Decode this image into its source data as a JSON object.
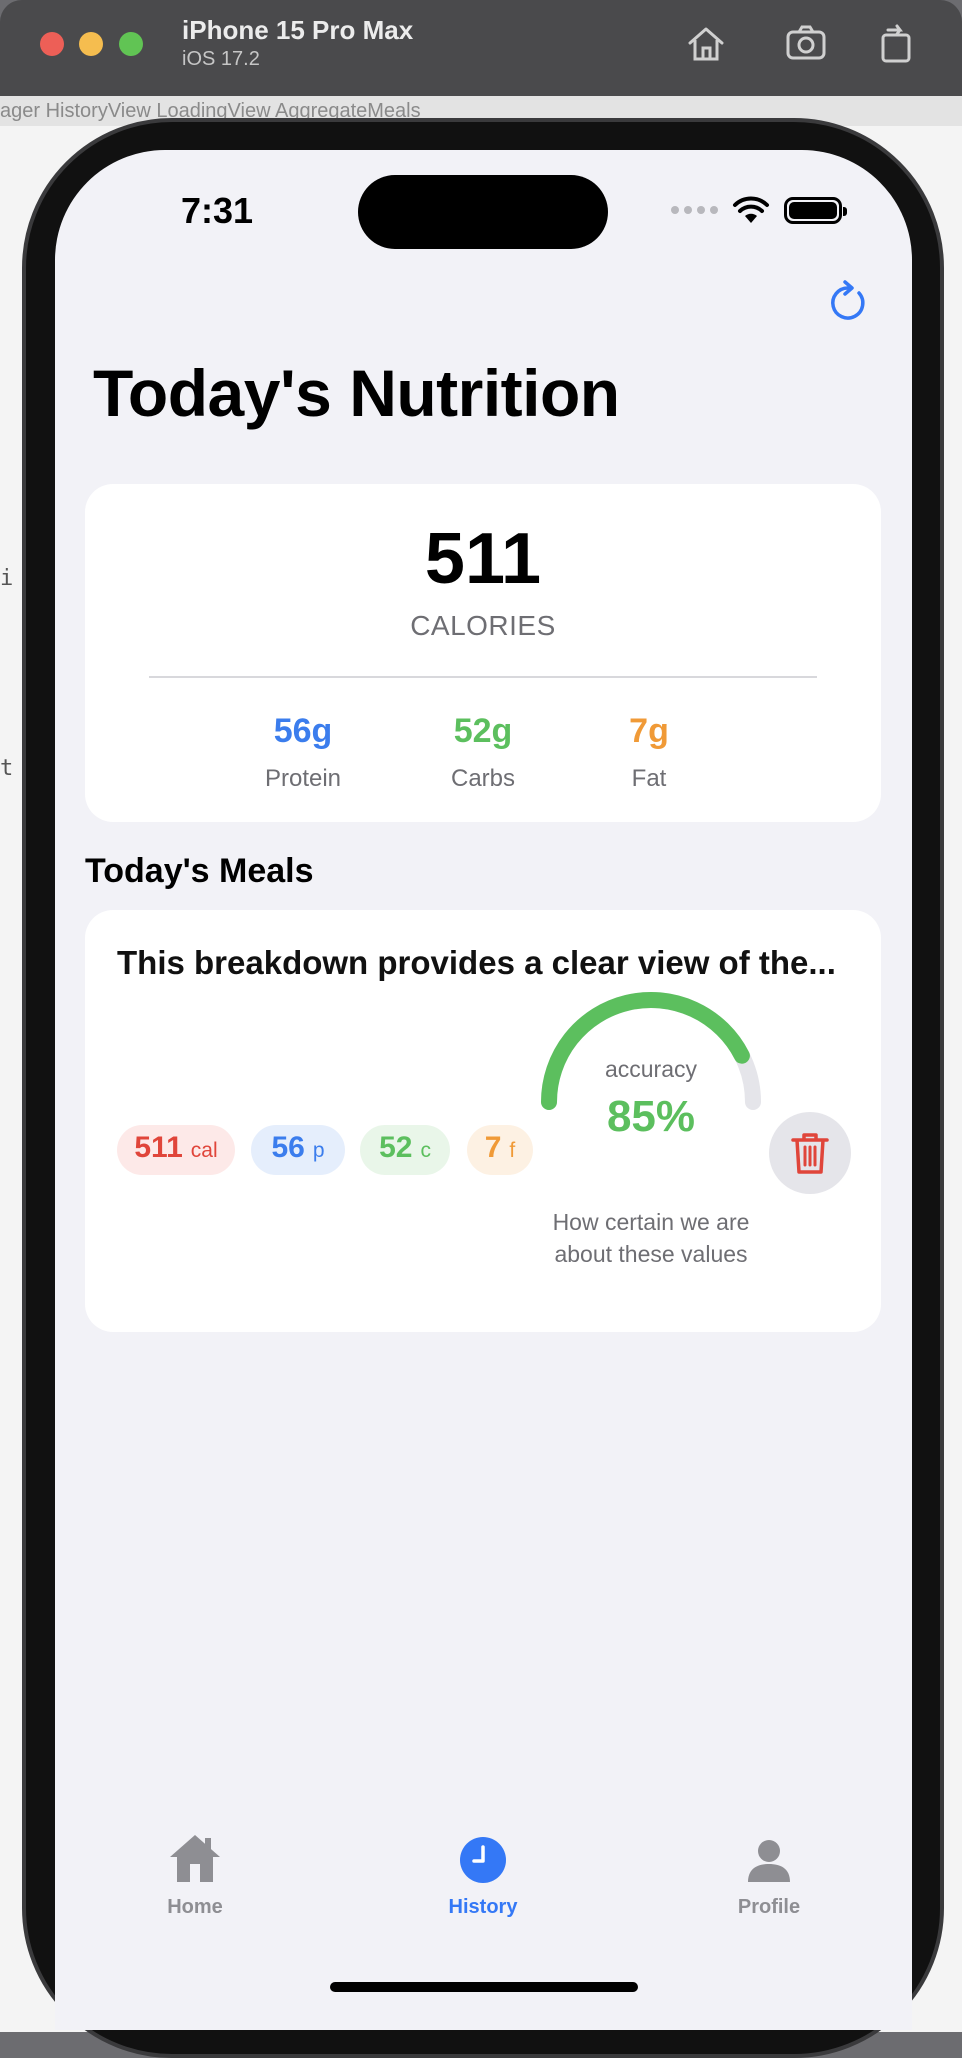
{
  "simulator": {
    "device_name": "iPhone 15 Pro Max",
    "os_version": "iOS 17.2",
    "buttons": [
      "home-icon",
      "camera-icon",
      "rotate-icon"
    ]
  },
  "background_editor": {
    "tabs_text": "ager      HistoryView      LoadingView      AggregateMeals"
  },
  "status_bar": {
    "time": "7:31",
    "icons": [
      "cellular-dots",
      "wifi-icon",
      "battery-icon"
    ]
  },
  "header": {
    "title": "Today's Nutrition",
    "refresh_icon": "refresh-icon"
  },
  "summary": {
    "calories": "511",
    "calories_label": "CALORIES",
    "macros": [
      {
        "value": "56g",
        "label": "Protein",
        "color": "#3b7ded"
      },
      {
        "value": "52g",
        "label": "Carbs",
        "color": "#5cbf5e"
      },
      {
        "value": "7g",
        "label": "Fat",
        "color": "#f09a37"
      }
    ]
  },
  "meals": {
    "section_title": "Today's Meals",
    "items": [
      {
        "title": "This breakdown provides a clear view of the...",
        "chips": [
          {
            "value": "511",
            "unit": "cal",
            "color": "#e0453a",
            "bg": "#fde9e8"
          },
          {
            "value": "56",
            "unit": "p",
            "color": "#3b7ded",
            "bg": "#e5eefc"
          },
          {
            "value": "52",
            "unit": "c",
            "color": "#5cbf5e",
            "bg": "#e9f6e9"
          },
          {
            "value": "7",
            "unit": "f",
            "color": "#f09a37",
            "bg": "#fdf1e3"
          }
        ],
        "accuracy_label": "accuracy",
        "accuracy_value": "85%",
        "accuracy_fraction": 0.85,
        "accuracy_caption": "How certain we are about these values",
        "delete_icon": "trash-icon"
      }
    ]
  },
  "tab_bar": {
    "tabs": [
      {
        "label": "Home",
        "icon": "house-icon",
        "active": false
      },
      {
        "label": "History",
        "icon": "clock-icon",
        "active": true
      },
      {
        "label": "Profile",
        "icon": "person-icon",
        "active": false
      }
    ],
    "active_color": "#3478f6",
    "inactive_color": "#8e8e93"
  }
}
